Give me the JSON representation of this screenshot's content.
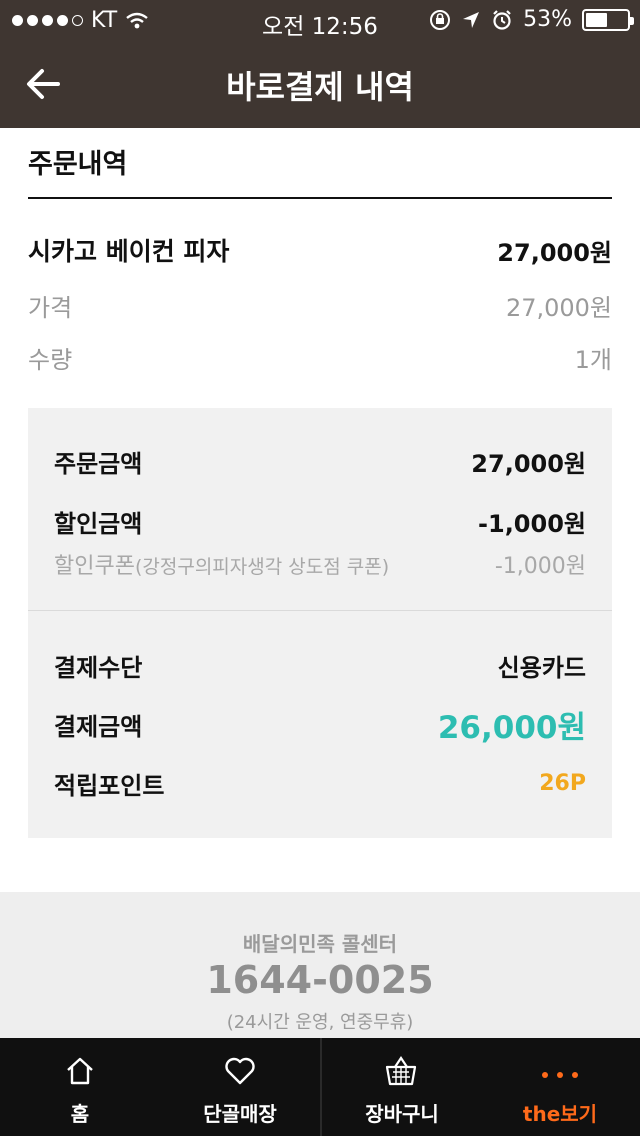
{
  "status_bar": {
    "carrier": "KT",
    "time": "오전 12:56",
    "battery": "53%",
    "battery_level": 0.53,
    "icons": [
      "signal-dots-icon",
      "wifi-icon",
      "orientation-lock-icon",
      "location-icon",
      "alarm-icon",
      "battery-icon"
    ]
  },
  "header": {
    "title": "바로결제 내역",
    "back_icon": "back-arrow-icon"
  },
  "order": {
    "section_title": "주문내역",
    "item_name": "시카고 베이컨 피자",
    "item_total": "27,000원",
    "price_label": "가격",
    "price_value": "27,000원",
    "quantity_label": "수량",
    "quantity_value": "1개"
  },
  "summary": {
    "order_amount_label": "주문금액",
    "order_amount_value": "27,000원",
    "discount_label": "할인금액",
    "discount_value": "-1,000원",
    "coupon_label": "할인쿠폰",
    "coupon_detail": "(강정구의피자생각 상도점 쿠폰)",
    "coupon_value": "-1,000원",
    "payment_method_label": "결제수단",
    "payment_method_value": "신용카드",
    "payment_amount_label": "결제금액",
    "payment_amount_value": "26,000원",
    "points_label": "적립포인트",
    "points_value": "26P"
  },
  "call_center": {
    "title": "배달의민족 콜센터",
    "phone": "1644-0025",
    "hours": "(24시간 운영, 연중무휴)"
  },
  "tabbar": {
    "tabs": [
      {
        "label": "홈",
        "icon": "home-icon"
      },
      {
        "label": "단골매장",
        "icon": "heart-icon"
      },
      {
        "label": "장바구니",
        "icon": "basket-icon"
      },
      {
        "label": "the보기",
        "icon": "more-dots-icon"
      }
    ],
    "active_color": "#ff6a1a"
  },
  "colors": {
    "header_bg": "#3f3631",
    "accent_teal": "#2dbdb1",
    "points_gold": "#f2a81e"
  }
}
